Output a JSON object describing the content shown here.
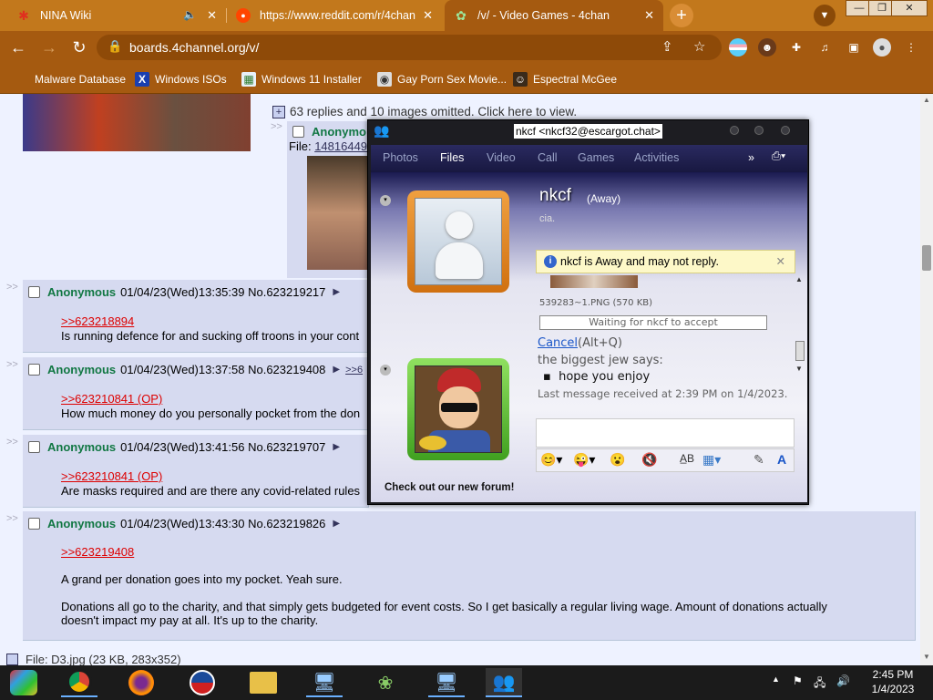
{
  "browser": {
    "tabs": [
      {
        "title": "NINA Wiki",
        "icon": "nina-favicon-icon",
        "color": "#e0301e"
      },
      {
        "title": "https://www.reddit.com/r/4chan",
        "icon": "reddit-favicon-icon",
        "color": "#ff4500"
      },
      {
        "title": "/v/ - Video Games - 4chan",
        "icon": "4chan-favicon-icon",
        "color": "#2a8a2a"
      }
    ],
    "url": "boards.4channel.org/v/",
    "bookmarks": [
      {
        "label": "Malware Database"
      },
      {
        "label": "Windows ISOs"
      },
      {
        "label": "Windows 11 Installer"
      },
      {
        "label": "Gay Porn Sex Movie..."
      },
      {
        "label": "Espectral McGee"
      }
    ],
    "theme_color": "#a55a10"
  },
  "page": {
    "omitted_text": "63 replies and 10 images omitted. Click here to view.",
    "partial_post": {
      "name": "Anonymo",
      "file_label": "File:",
      "file_link": "14816449"
    },
    "posts": [
      {
        "name": "Anonymous",
        "meta": "01/04/23(Wed)13:35:39 No.623219217",
        "menu": "▶",
        "backlink": "",
        "quote": ">>623218894",
        "text": "Is running defence for and sucking off troons in your cont"
      },
      {
        "name": "Anonymous",
        "meta": "01/04/23(Wed)13:37:58 No.623219408",
        "menu": "▶",
        "backlink": ">>6",
        "quote": ">>623210841 (OP)",
        "text": "How much money do you personally pocket from the don"
      },
      {
        "name": "Anonymous",
        "meta": "01/04/23(Wed)13:41:56 No.623219707",
        "menu": "▶",
        "backlink": "",
        "quote": ">>623210841 (OP)",
        "text": "Are masks required and are there any covid-related rules"
      },
      {
        "name": "Anonymous",
        "meta": "01/04/23(Wed)13:43:30 No.623219826",
        "menu": "▶",
        "backlink": "",
        "quote": ">>623219408",
        "text1": "A grand per donation goes into my pocket. Yeah sure.",
        "text2": "Donations all go to the charity, and that simply gets budgeted for event costs. So I get basically a regular living wage. Amount of donations actually doesn't impact my pay at all. It's up to the charity."
      }
    ],
    "next_file": "File: D3.jpg (23 KB, 283x352)"
  },
  "messenger": {
    "title": "nkcf <nkcf32@escargot.chat>",
    "tabs": [
      "Photos",
      "Files",
      "Video",
      "Call",
      "Games",
      "Activities"
    ],
    "active_tab": "Files",
    "more": "»",
    "contact_name": "nkcf",
    "contact_status": "(Away)",
    "personal_message": "cia.",
    "away_notice": "nkcf is Away and may not reply.",
    "file_name": "539283~1.PNG (570 KB)",
    "file_status": "Waiting for nkcf to accept",
    "cancel_link": "Cancel",
    "cancel_shortcut": "(Alt+Q)",
    "sender_says": "the biggest jew says:",
    "message_item": "hope you enjoy",
    "last_received": "Last message received at 2:39 PM on 1/4/2023.",
    "forum_text": "Check out our new forum!"
  },
  "taskbar": {
    "time": "2:45 PM",
    "date": "1/4/2023"
  }
}
